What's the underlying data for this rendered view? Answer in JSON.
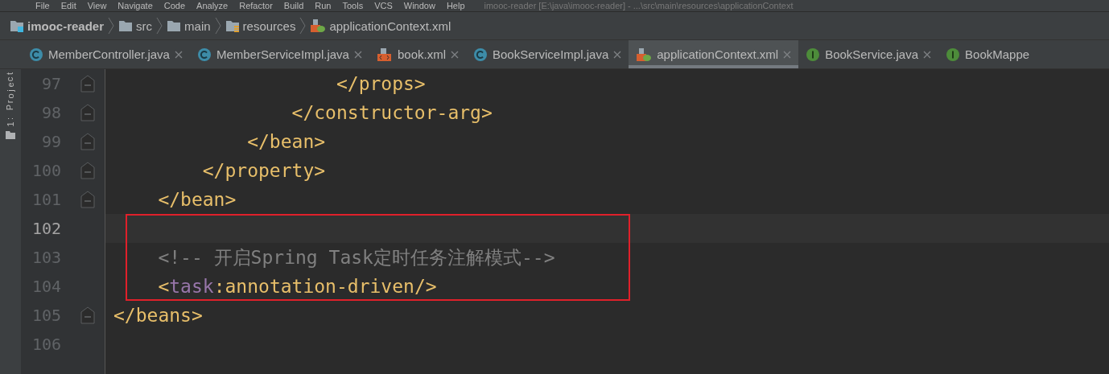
{
  "menu_bar": {
    "items": [
      "File",
      "Edit",
      "View",
      "Navigate",
      "Code",
      "Analyze",
      "Refactor",
      "Build",
      "Run",
      "Tools",
      "VCS",
      "Window",
      "Help"
    ],
    "title": "imooc-reader [E:\\java\\imooc-reader] - ...\\src\\main\\resources\\applicationContext"
  },
  "breadcrumb": [
    {
      "label": "imooc-reader",
      "kind": "project"
    },
    {
      "label": "src",
      "kind": "folder"
    },
    {
      "label": "main",
      "kind": "folder"
    },
    {
      "label": "resources",
      "kind": "resources"
    },
    {
      "label": "applicationContext.xml",
      "kind": "spring-xml"
    }
  ],
  "tabs": [
    {
      "label": "MemberController.java",
      "kind": "class",
      "selected": false
    },
    {
      "label": "MemberServiceImpl.java",
      "kind": "class",
      "selected": false
    },
    {
      "label": "book.xml",
      "kind": "xml",
      "selected": false
    },
    {
      "label": "BookServiceImpl.java",
      "kind": "class",
      "selected": false
    },
    {
      "label": "applicationContext.xml",
      "kind": "spring-xml",
      "selected": true
    },
    {
      "label": "BookService.java",
      "kind": "interface",
      "selected": false
    },
    {
      "label": "BookMappe",
      "kind": "interface",
      "selected": false
    }
  ],
  "side_tool": {
    "label": "1: Project"
  },
  "editor": {
    "lines": [
      {
        "number": "97",
        "fold": true,
        "current": false,
        "boxed": false,
        "tokens": [
          {
            "kind": "tag",
            "text": "                    </props>"
          }
        ]
      },
      {
        "number": "98",
        "fold": true,
        "current": false,
        "boxed": false,
        "tokens": [
          {
            "kind": "tag",
            "text": "                </constructor-arg>"
          }
        ]
      },
      {
        "number": "99",
        "fold": true,
        "current": false,
        "boxed": false,
        "tokens": [
          {
            "kind": "tag",
            "text": "            </bean>"
          }
        ]
      },
      {
        "number": "100",
        "fold": true,
        "current": false,
        "boxed": false,
        "tokens": [
          {
            "kind": "tag",
            "text": "        </property>"
          }
        ]
      },
      {
        "number": "101",
        "fold": true,
        "current": false,
        "boxed": false,
        "tokens": [
          {
            "kind": "tag",
            "text": "    </bean>"
          }
        ]
      },
      {
        "number": "102",
        "fold": false,
        "current": true,
        "boxed": true
      },
      {
        "number": "103",
        "fold": false,
        "current": false,
        "boxed": true,
        "tokens": [
          {
            "kind": "comment",
            "text": "    <!-- 开启Spring Task定时任务注解模式-->"
          }
        ]
      },
      {
        "number": "104",
        "fold": false,
        "current": false,
        "boxed": true,
        "tokens": [
          {
            "kind": "tag",
            "text": "    <"
          },
          {
            "kind": "namespace",
            "text": "task"
          },
          {
            "kind": "tag",
            "text": ":annotation-driven/>"
          }
        ]
      },
      {
        "number": "105",
        "fold": true,
        "current": false,
        "boxed": false,
        "tokens": [
          {
            "kind": "tag",
            "text": "</beans>"
          }
        ]
      },
      {
        "number": "106",
        "fold": false,
        "current": false,
        "boxed": false
      }
    ]
  }
}
